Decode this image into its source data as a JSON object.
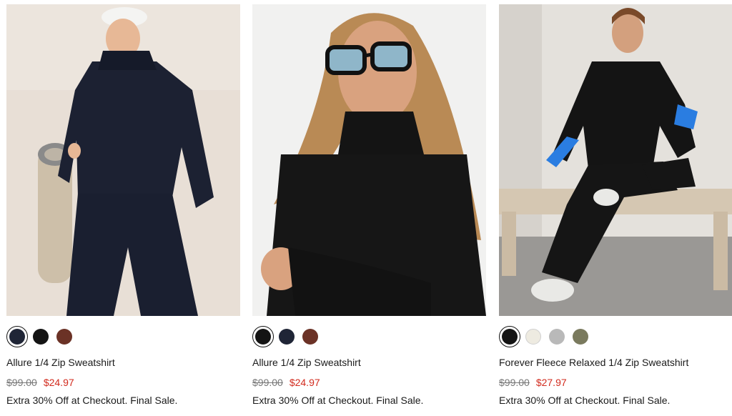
{
  "products": [
    {
      "name": "Allure 1/4 Zip Sweatshirt",
      "original_price": "$99.00",
      "sale_price": "$24.97",
      "promo": "Extra 30% Off at Checkout. Final Sale.",
      "swatches": [
        {
          "color": "#1f2536",
          "selected": true
        },
        {
          "color": "#141414",
          "selected": false
        },
        {
          "color": "#6b3226",
          "selected": false
        }
      ]
    },
    {
      "name": "Allure 1/4 Zip Sweatshirt",
      "original_price": "$99.00",
      "sale_price": "$24.97",
      "promo": "Extra 30% Off at Checkout. Final Sale.",
      "swatches": [
        {
          "color": "#141414",
          "selected": true
        },
        {
          "color": "#1f2536",
          "selected": false
        },
        {
          "color": "#6b3226",
          "selected": false
        }
      ]
    },
    {
      "name": "Forever Fleece Relaxed 1/4 Zip Sweatshirt",
      "original_price": "$99.00",
      "sale_price": "$27.97",
      "promo": "Extra 30% Off at Checkout. Final Sale.",
      "swatches": [
        {
          "color": "#141414",
          "selected": true
        },
        {
          "color": "#eeebe1",
          "selected": false
        },
        {
          "color": "#b9b9b9",
          "selected": false
        },
        {
          "color": "#7a7a5e",
          "selected": false
        }
      ]
    }
  ],
  "colors": {
    "sale_price": "#d22b1e",
    "original_price": "#777777",
    "text": "#1a1a1a"
  }
}
